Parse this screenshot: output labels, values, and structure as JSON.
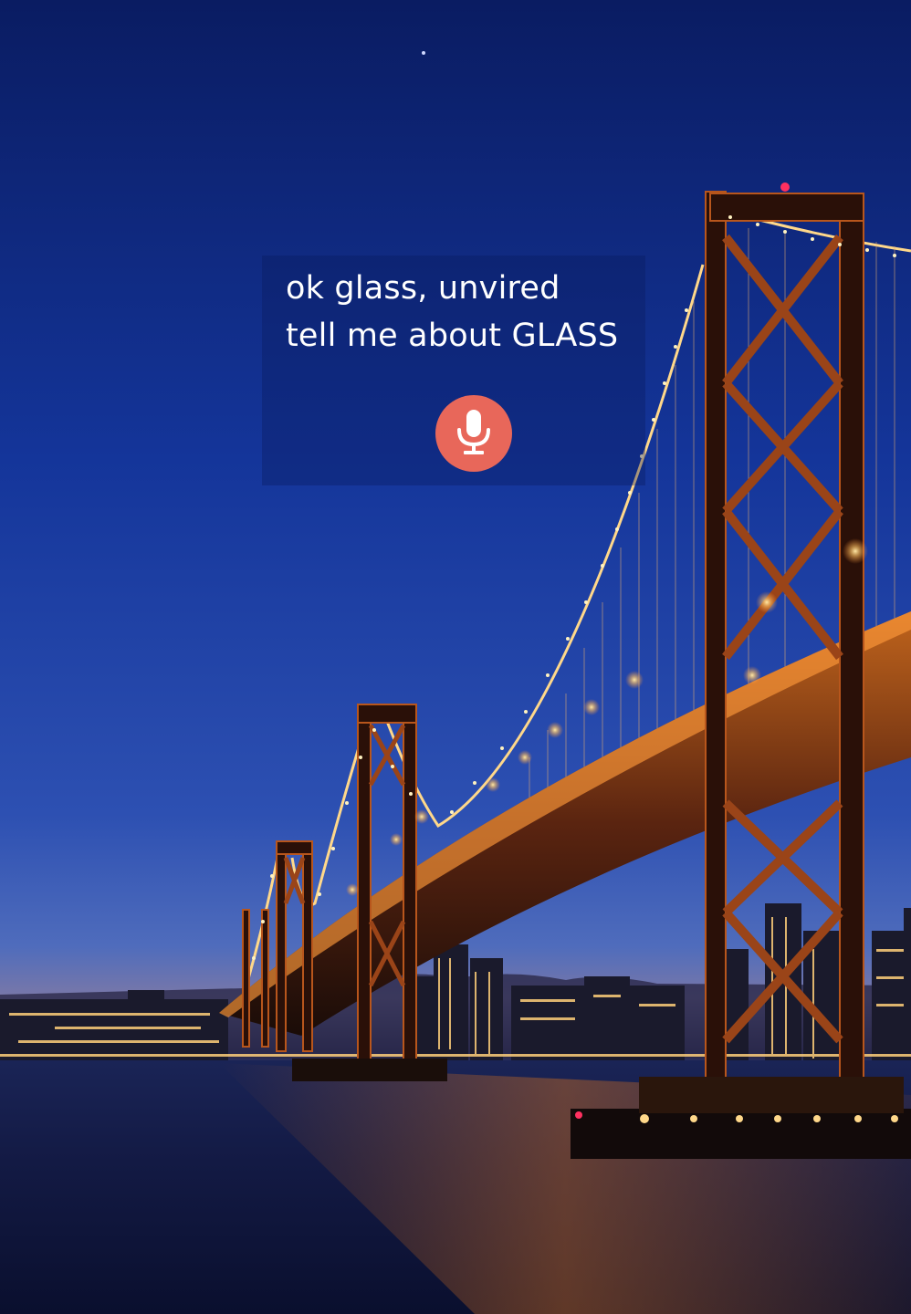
{
  "voice_prompt": {
    "line1": "ok glass, unvired",
    "line2": "tell me about GLASS"
  },
  "mic": {
    "icon": "microphone-icon",
    "color": "#e8675a"
  },
  "background": {
    "scene": "night-suspension-bridge",
    "colors": {
      "sky_top": "#0b1e66",
      "sky_mid": "#1a3a9a",
      "sky_horizon": "#3d5ab0",
      "water": "#0d1640",
      "bridge_lights": "#ffd27a",
      "tower": "#3a1a10"
    }
  }
}
